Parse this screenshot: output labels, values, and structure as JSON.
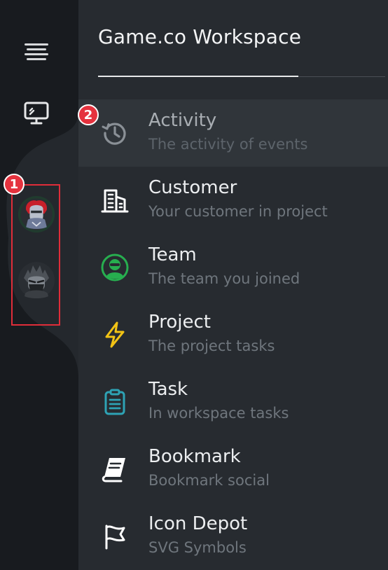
{
  "workspace": {
    "title": "Game.co Workspace"
  },
  "rail": {
    "items": [
      {
        "icon": "hamburger-menu-icon"
      },
      {
        "icon": "monitor-icon"
      },
      {
        "icon": "red-knight-avatar-icon"
      },
      {
        "icon": "dark-ninja-avatar-icon"
      }
    ]
  },
  "menu": {
    "items": [
      {
        "title": "Activity",
        "subtitle": "The activity of events",
        "icon": "history-icon",
        "color": "#8a9096"
      },
      {
        "title": "Customer",
        "subtitle": "Your customer in project",
        "icon": "building-icon",
        "color": "#ffffff"
      },
      {
        "title": "Team",
        "subtitle": "The team you joined",
        "icon": "team-icon",
        "color": "#27ae4f"
      },
      {
        "title": "Project",
        "subtitle": "The project tasks",
        "icon": "lightning-icon",
        "color": "#f2c315"
      },
      {
        "title": "Task",
        "subtitle": "In workspace tasks",
        "icon": "clipboard-icon",
        "color": "#2ea3b5"
      },
      {
        "title": "Bookmark",
        "subtitle": "Bookmark social",
        "icon": "book-icon",
        "color": "#ffffff"
      },
      {
        "title": "Icon Depot",
        "subtitle": "SVG Symbols",
        "icon": "flag-icon",
        "color": "#ffffff"
      }
    ]
  },
  "callouts": [
    {
      "label": "1"
    },
    {
      "label": "2"
    }
  ],
  "colors": {
    "accent": "#e5323e",
    "rail": "#1c2024",
    "panel": "#272b30",
    "active_row": "#30353a"
  }
}
